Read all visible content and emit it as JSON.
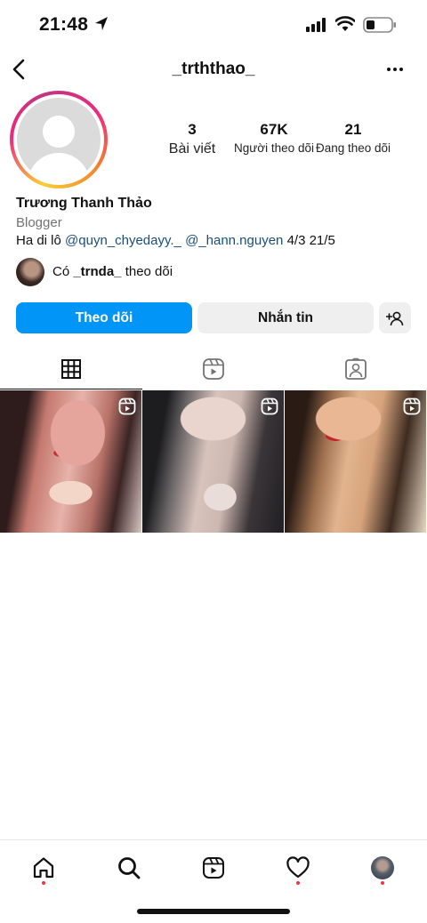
{
  "status_bar": {
    "time": "21:48",
    "icons": [
      "location-arrow-icon",
      "signal-icon",
      "wifi-icon",
      "battery-icon"
    ]
  },
  "header": {
    "username": "_trththao_",
    "back_icon": "chevron-left-icon",
    "more_icon": "more-horizontal-icon"
  },
  "profile": {
    "stats": {
      "posts": {
        "value": "3",
        "label": "Bài viết"
      },
      "followers": {
        "value": "67K",
        "label": "Người theo dõi"
      },
      "following": {
        "value": "21",
        "label": "Đang theo dõi"
      }
    },
    "full_name": "Trương Thanh Thảo",
    "category": "Blogger",
    "bio": {
      "prefix": "Ha di lô ",
      "mention_1": "@quyn_chyedayy._",
      "mention_2": "@_hann.nguyen",
      "suffix": " 4/3 21/5"
    },
    "followed_by": {
      "prefix": "Có ",
      "username": "_trnda_",
      "suffix": " theo dõi"
    }
  },
  "actions": {
    "follow_label": "Theo dõi",
    "message_label": "Nhắn tin",
    "add_user_icon": "add-user-icon"
  },
  "tabs": [
    {
      "name": "posts",
      "icon": "grid-icon",
      "active": true
    },
    {
      "name": "reels",
      "icon": "reels-icon",
      "active": false
    },
    {
      "name": "tagged",
      "icon": "tagged-icon",
      "active": false
    }
  ],
  "posts": [
    {
      "type": "reel"
    },
    {
      "type": "reel"
    },
    {
      "type": "reel"
    }
  ],
  "bottom_nav": [
    {
      "name": "home",
      "icon": "home-icon",
      "notification_dot": true
    },
    {
      "name": "search",
      "icon": "search-icon",
      "notification_dot": false
    },
    {
      "name": "reels",
      "icon": "reels-icon",
      "notification_dot": false
    },
    {
      "name": "activity",
      "icon": "heart-icon",
      "notification_dot": true
    },
    {
      "name": "profile",
      "icon": "avatar",
      "notification_dot": true
    }
  ],
  "colors": {
    "accent": "#0095f6",
    "mention": "#1a4e7a",
    "notification": "#ff3040",
    "secondary_button": "#efefef"
  }
}
